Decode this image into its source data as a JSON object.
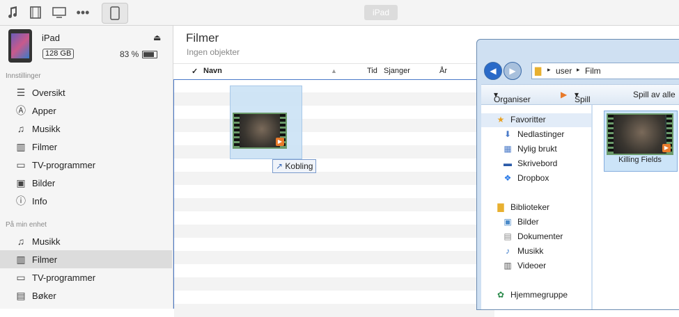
{
  "toolbar": {
    "icons": [
      "music-note-icon",
      "film-icon",
      "tv-icon",
      "more-icon",
      "ipad-icon"
    ],
    "device_title": "iPad"
  },
  "device": {
    "name": "iPad",
    "capacity": "128 GB",
    "battery": "83 %"
  },
  "sidebar": {
    "settings_header": "Innstillinger",
    "settings_items": [
      {
        "label": "Oversikt",
        "icon": "overview-icon"
      },
      {
        "label": "Apper",
        "icon": "apps-icon"
      },
      {
        "label": "Musikk",
        "icon": "music-icon"
      },
      {
        "label": "Filmer",
        "icon": "film-icon"
      },
      {
        "label": "TV-programmer",
        "icon": "tv-icon"
      },
      {
        "label": "Bilder",
        "icon": "camera-icon"
      },
      {
        "label": "Info",
        "icon": "info-icon"
      }
    ],
    "device_header": "På min enhet",
    "device_items": [
      {
        "label": "Musikk",
        "icon": "music-icon"
      },
      {
        "label": "Filmer",
        "icon": "film-icon",
        "selected": true
      },
      {
        "label": "TV-programmer",
        "icon": "tv-icon"
      },
      {
        "label": "Bøker",
        "icon": "book-icon"
      }
    ]
  },
  "main": {
    "title": "Filmer",
    "subtitle": "Ingen objekter",
    "columns": {
      "check": "✓",
      "name": "Navn",
      "time": "Tid",
      "genre": "Sjanger",
      "year": "År"
    }
  },
  "drag": {
    "link_label": "Kobling"
  },
  "explorer": {
    "path": [
      "user",
      "Film"
    ],
    "commands": [
      "Organiser",
      "Spill av",
      "Spill av alle"
    ],
    "favorites_header": "Favoritter",
    "favorites": [
      "Nedlastinger",
      "Nylig brukt",
      "Skrivebord",
      "Dropbox"
    ],
    "libraries_header": "Biblioteker",
    "libraries": [
      "Bilder",
      "Dokumenter",
      "Musikk",
      "Videoer"
    ],
    "homegroup": "Hjemmegruppe",
    "file_name": "Killing Fields"
  }
}
